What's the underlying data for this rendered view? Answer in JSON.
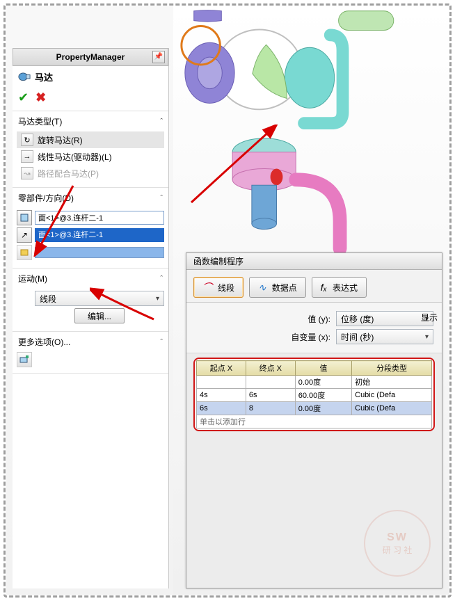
{
  "pm": {
    "header": "PropertyManager",
    "title": "马达",
    "sections": {
      "motorType": {
        "title": "马达类型(T)",
        "options": {
          "rotary": "旋转马达(R)",
          "linear": "线性马达(驱动器)(L)",
          "path": "路径配合马达(P)"
        }
      },
      "compDir": {
        "title": "零部件/方向(D)",
        "face1": "面<1>@3.连杆二-1",
        "face2": "面<1>@3.连杆二-1"
      },
      "motion": {
        "title": "运动(M)",
        "type": "线段",
        "editBtn": "编辑..."
      },
      "more": {
        "title": "更多选项(O)..."
      }
    }
  },
  "fb": {
    "title": "函数编制程序",
    "tabs": {
      "seg": "线段",
      "pts": "数据点",
      "expr": "表达式",
      "exprIcon": "fₓ"
    },
    "params": {
      "valueLbl": "值 (y):",
      "valueSel": "位移 (度)",
      "ivarLbl": "自变量 (x):",
      "ivarSel": "时间 (秒)"
    },
    "sideLabel": "显示",
    "cols": {
      "startX": "起点 X",
      "endX": "终点 X",
      "value": "值",
      "segType": "分段类型"
    },
    "rows": [
      {
        "startX": "",
        "endX": "",
        "value": "0.00度",
        "segType": "初始"
      },
      {
        "startX": "4s",
        "endX": "6s",
        "value": "60.00度",
        "segType": "Cubic (Defa"
      },
      {
        "startX": "6s",
        "endX": "8",
        "value": "0.00度",
        "segType": "Cubic (Defa"
      }
    ],
    "addRow": "单击以添加行"
  },
  "watermark": {
    "sw": "SW",
    "txt": "研 习 社"
  }
}
